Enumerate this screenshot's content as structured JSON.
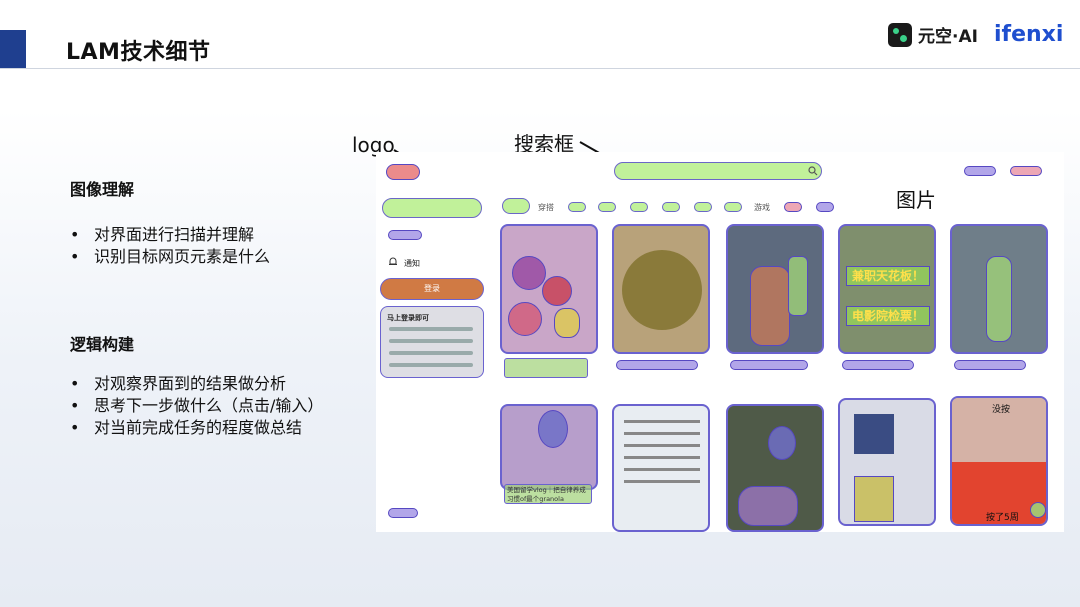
{
  "header": {
    "title": "LAM技术细节"
  },
  "brand": {
    "cn": "元空·AI",
    "en": "ifenxi"
  },
  "sections": [
    {
      "heading": "图像理解",
      "bullets": [
        "对界面进行扫描并理解",
        "识别目标网页元素是什么"
      ]
    },
    {
      "heading": "逻辑构建",
      "bullets": [
        "对观察界面到的结果做分析",
        "思考下一步做什么（点击/输入）",
        "对当前完成任务的程度做总结"
      ]
    }
  ],
  "annotations": {
    "logo": "logo",
    "search": "搜索框",
    "image": "图片"
  },
  "screenshot": {
    "sidebar": {
      "notify": "通知",
      "login_button": "登录",
      "login_prompt": "马上登录即可"
    },
    "tabs": {
      "tab2": "穿搭",
      "tab9": "游戏"
    },
    "cards": {
      "card1_cap": "美国留学vlog｜把自律养成习惯of最个granola",
      "card_face_top": "没按",
      "card_face_bottom": "按了5周",
      "poster_line1": "兼职天花板！",
      "poster_line2": "电影院检票！"
    }
  },
  "colors": {
    "accent": "#1f3f8f",
    "brand_blue": "#1f4fcf",
    "overlay_green": "#acec78",
    "overlay_purple": "#9888e2"
  }
}
